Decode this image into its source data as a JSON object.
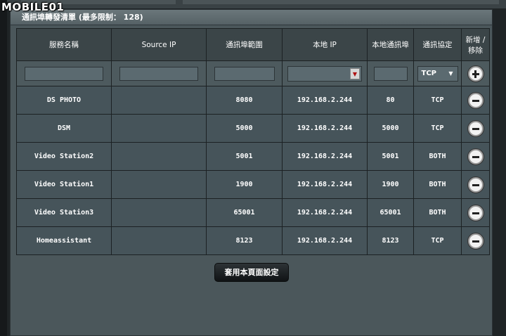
{
  "watermark": "MOBILE01",
  "panel": {
    "title": "通訊埠轉發清單 (最多限制： 128)"
  },
  "table": {
    "headers": [
      "服務名稱",
      "Source IP",
      "通訊埠範圍",
      "本地 IP",
      "本地通訊埠",
      "通訊協定",
      "新增 / 移除"
    ],
    "new_entry": {
      "service_name": "",
      "source_ip": "",
      "port_range": "",
      "local_ip": "",
      "local_port": "",
      "protocol": "TCP"
    },
    "rows": [
      {
        "name": "DS PHOTO",
        "source_ip": "",
        "port_range": "8080",
        "local_ip": "192.168.2.244",
        "local_port": "80",
        "protocol": "TCP"
      },
      {
        "name": "DSM",
        "source_ip": "",
        "port_range": "5000",
        "local_ip": "192.168.2.244",
        "local_port": "5000",
        "protocol": "TCP"
      },
      {
        "name": "Video Station2",
        "source_ip": "",
        "port_range": "5001",
        "local_ip": "192.168.2.244",
        "local_port": "5001",
        "protocol": "BOTH"
      },
      {
        "name": "Video Station1",
        "source_ip": "",
        "port_range": "1900",
        "local_ip": "192.168.2.244",
        "local_port": "1900",
        "protocol": "BOTH"
      },
      {
        "name": "Video Station3",
        "source_ip": "",
        "port_range": "65001",
        "local_ip": "192.168.2.244",
        "local_port": "65001",
        "protocol": "BOTH"
      },
      {
        "name": "Homeassistant",
        "source_ip": "",
        "port_range": "8123",
        "local_ip": "192.168.2.244",
        "local_port": "8123",
        "protocol": "TCP"
      }
    ]
  },
  "apply_label": "套用本頁面設定",
  "icons": {
    "add": "plus-circle-icon",
    "remove": "minus-circle-icon",
    "dropdown": "chevron-down-icon"
  },
  "colors": {
    "panel_bg": "#4b575b",
    "header_bg": "#3b4548",
    "row_bg": "#46545a",
    "page_bg": "#1f2426"
  }
}
